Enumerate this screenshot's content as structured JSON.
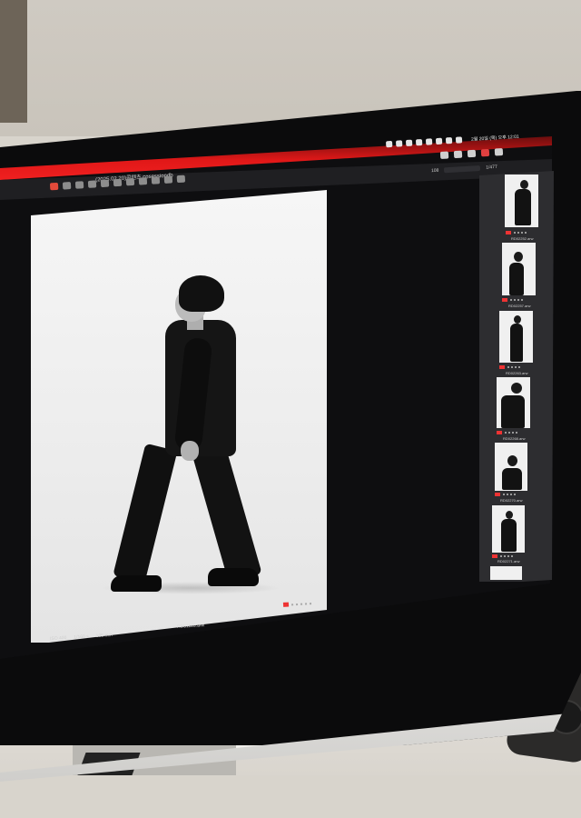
{
  "app": {
    "document_title": "(2025.02.20)콘텐츠.cosessiondb",
    "clock": "2월 20일 (목) 오후 12:01"
  },
  "toolbar": {
    "zoom": "108",
    "counter": "1/477"
  },
  "viewer": {
    "filename": "RD01128.arw",
    "status": {
      "iso": "ISO 400",
      "shutter": "1/160 s",
      "focal": "105 mm"
    }
  },
  "filmstrip": {
    "items": [
      {
        "label": "RD02252.arw"
      },
      {
        "label": "RD02257.arw"
      },
      {
        "label": "RD02263.arw"
      },
      {
        "label": "RD02268.arw"
      },
      {
        "label": "RD02270.arw"
      },
      {
        "label": "RD02271.arw"
      }
    ]
  },
  "icons": {
    "apple": "apple-logo-icon"
  }
}
